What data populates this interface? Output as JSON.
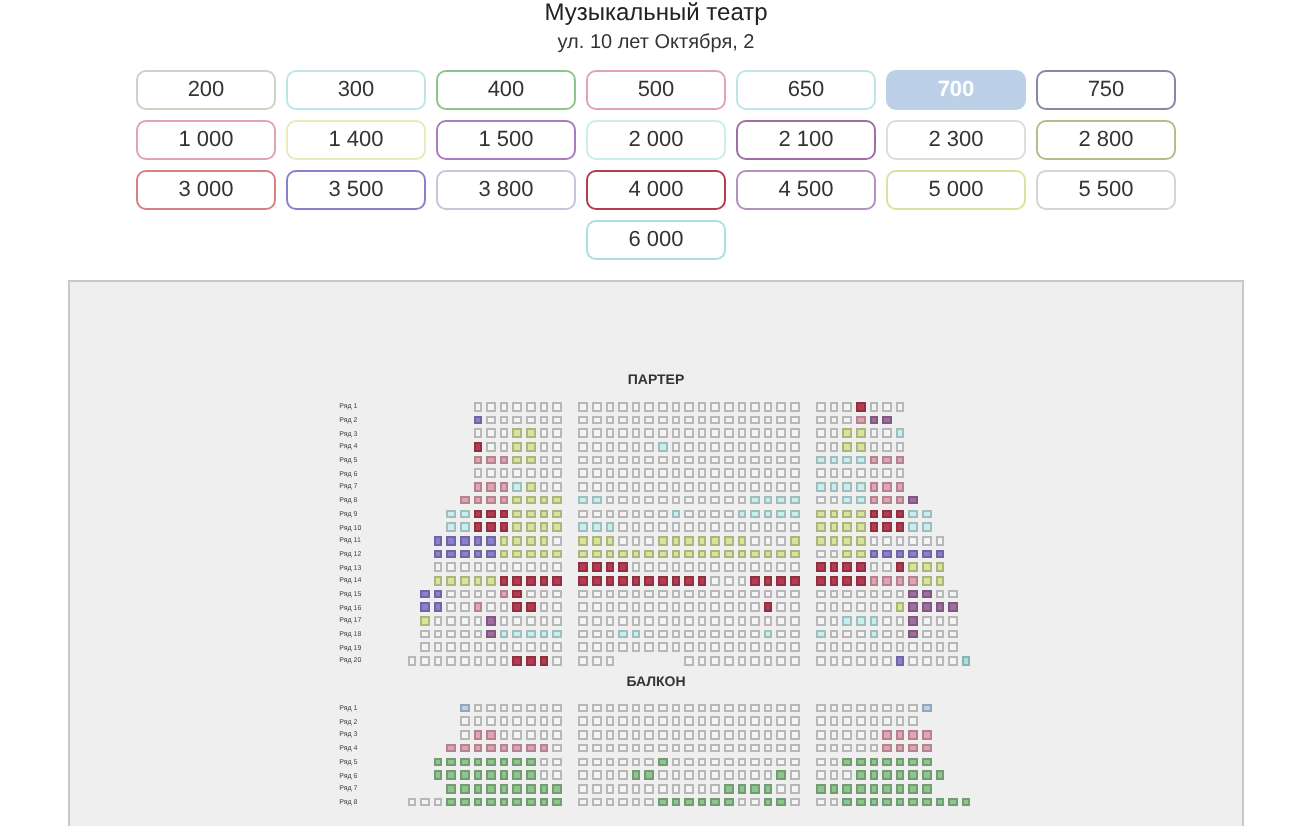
{
  "venue": {
    "title": "Музыкальный театр",
    "address": "ул. 10 лет Октября, 2"
  },
  "prices": [
    {
      "label": "200",
      "color": "#c9d4c4",
      "selected": false
    },
    {
      "label": "300",
      "color": "#bfe6e6",
      "selected": false
    },
    {
      "label": "400",
      "color": "#8fc48f",
      "selected": false
    },
    {
      "label": "500",
      "color": "#e0a4b4",
      "selected": false
    },
    {
      "label": "650",
      "color": "#bfe6e6",
      "selected": false
    },
    {
      "label": "700",
      "color": "#bcd0e8",
      "selected": true
    },
    {
      "label": "750",
      "color": "#8a86a8",
      "selected": false
    },
    {
      "label": "1 000",
      "color": "#e0a4b4",
      "selected": false
    },
    {
      "label": "1 400",
      "color": "#e8ecb8",
      "selected": false
    },
    {
      "label": "1 500",
      "color": "#a87cc0",
      "selected": false
    },
    {
      "label": "2 000",
      "color": "#c8eeee",
      "selected": false
    },
    {
      "label": "2 100",
      "color": "#a06ea0",
      "selected": false
    },
    {
      "label": "2 300",
      "color": "#dddddd",
      "selected": false
    },
    {
      "label": "2 800",
      "color": "#b4bc8c",
      "selected": false
    },
    {
      "label": "3 000",
      "color": "#d88080",
      "selected": false
    },
    {
      "label": "3 500",
      "color": "#8c80cc",
      "selected": false
    },
    {
      "label": "3 800",
      "color": "#c8c4dc",
      "selected": false
    },
    {
      "label": "4 000",
      "color": "#b43c50",
      "selected": false
    },
    {
      "label": "4 500",
      "color": "#b490bc",
      "selected": false
    },
    {
      "label": "5 000",
      "color": "#d8e49c",
      "selected": false
    },
    {
      "label": "5 500",
      "color": "#d4d4d4",
      "selected": false
    },
    {
      "label": "6 000",
      "color": "#a8e0e0",
      "selected": false
    }
  ],
  "sections": [
    {
      "title": "ПАРТЕР",
      "rows": [
        "Ряд 1",
        "Ряд 2",
        "Ряд 3",
        "Ряд 4",
        "Ряд 5",
        "Ряд 6",
        "Ряд 7",
        "Ряд 8",
        "Ряд 9",
        "Ряд 10",
        "Ряд 11",
        "Ряд 12",
        "Ряд 13",
        "Ряд 14",
        "Ряд 15",
        "Ряд 16",
        "Ряд 17",
        "Ряд 18",
        "Ряд 19",
        "Ряд 20"
      ]
    },
    {
      "title": "БАЛКОН",
      "rows": [
        "Ряд 1",
        "Ряд 2",
        "Ряд 3",
        "Ряд 4",
        "Ряд 5",
        "Ряд 6",
        "Ряд 7",
        "Ряд 8"
      ]
    }
  ]
}
